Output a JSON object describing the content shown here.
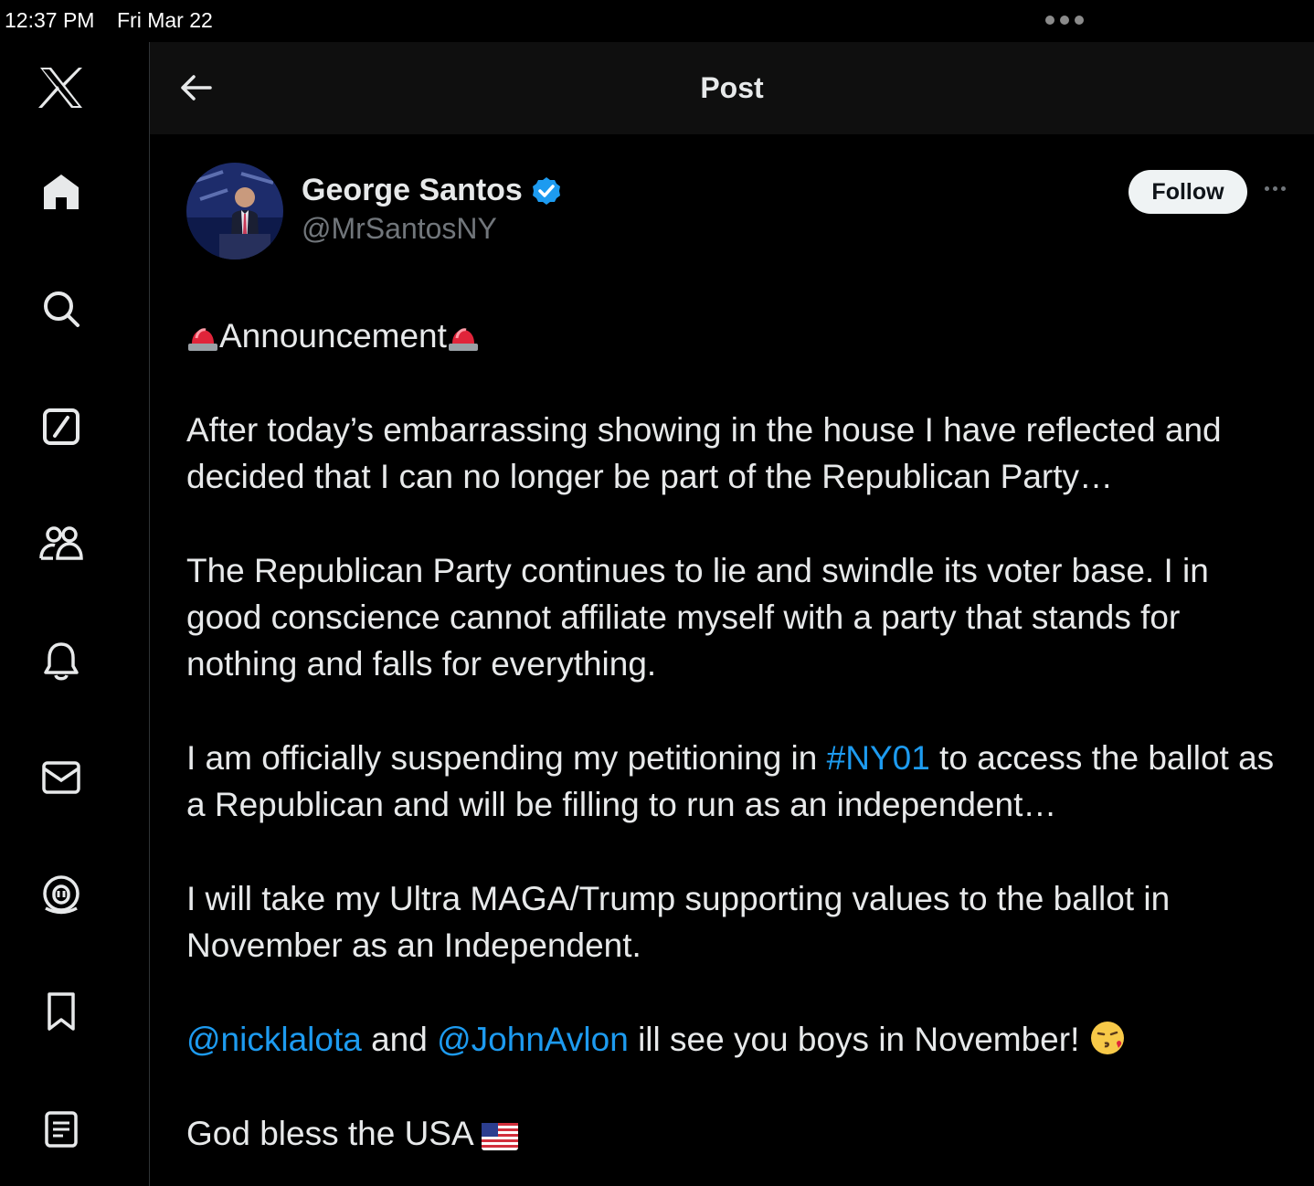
{
  "status_bar": {
    "time": "12:37 PM",
    "date": "Fri Mar 22"
  },
  "sidebar": {
    "items": [
      {
        "icon": "x-logo-icon"
      },
      {
        "icon": "home-icon"
      },
      {
        "icon": "search-icon"
      },
      {
        "icon": "grok-icon"
      },
      {
        "icon": "communities-icon"
      },
      {
        "icon": "notifications-icon"
      },
      {
        "icon": "messages-icon"
      },
      {
        "icon": "spaces-icon"
      },
      {
        "icon": "bookmarks-icon"
      },
      {
        "icon": "lists-icon"
      }
    ]
  },
  "header": {
    "title": "Post",
    "back_icon": "back-arrow-icon"
  },
  "post": {
    "author": {
      "name": "George Santos",
      "handle": "@MrSantosNY",
      "verified": true,
      "verified_color": "#1d9bf0"
    },
    "follow_label": "Follow",
    "announcement": "Announcement",
    "paragraph_1": "After today’s embarrassing showing in the house I have reflected and decided that I can no longer be part of the Republican Party…",
    "paragraph_2": "The Republican Party continues to lie and swindle its voter base. I in good conscience cannot affiliate myself with a party that stands for nothing and falls for everything.",
    "paragraph_3_before": "I am officially suspending my petitioning in ",
    "paragraph_3_hashtag": "#NY01",
    "paragraph_3_after": " to access the ballot as a Republican and will be filling to run as an independent…",
    "paragraph_4": "I will take my Ultra MAGA/Trump supporting values to the ballot in November as an Independent.",
    "mention_1": "@nicklalota",
    "paragraph_5_and": " and ",
    "mention_2": "@JohnAvlon",
    "paragraph_5_after": " ill see you boys in November! ",
    "paragraph_6": "God bless the USA ",
    "link_color": "#1d9bf0"
  }
}
